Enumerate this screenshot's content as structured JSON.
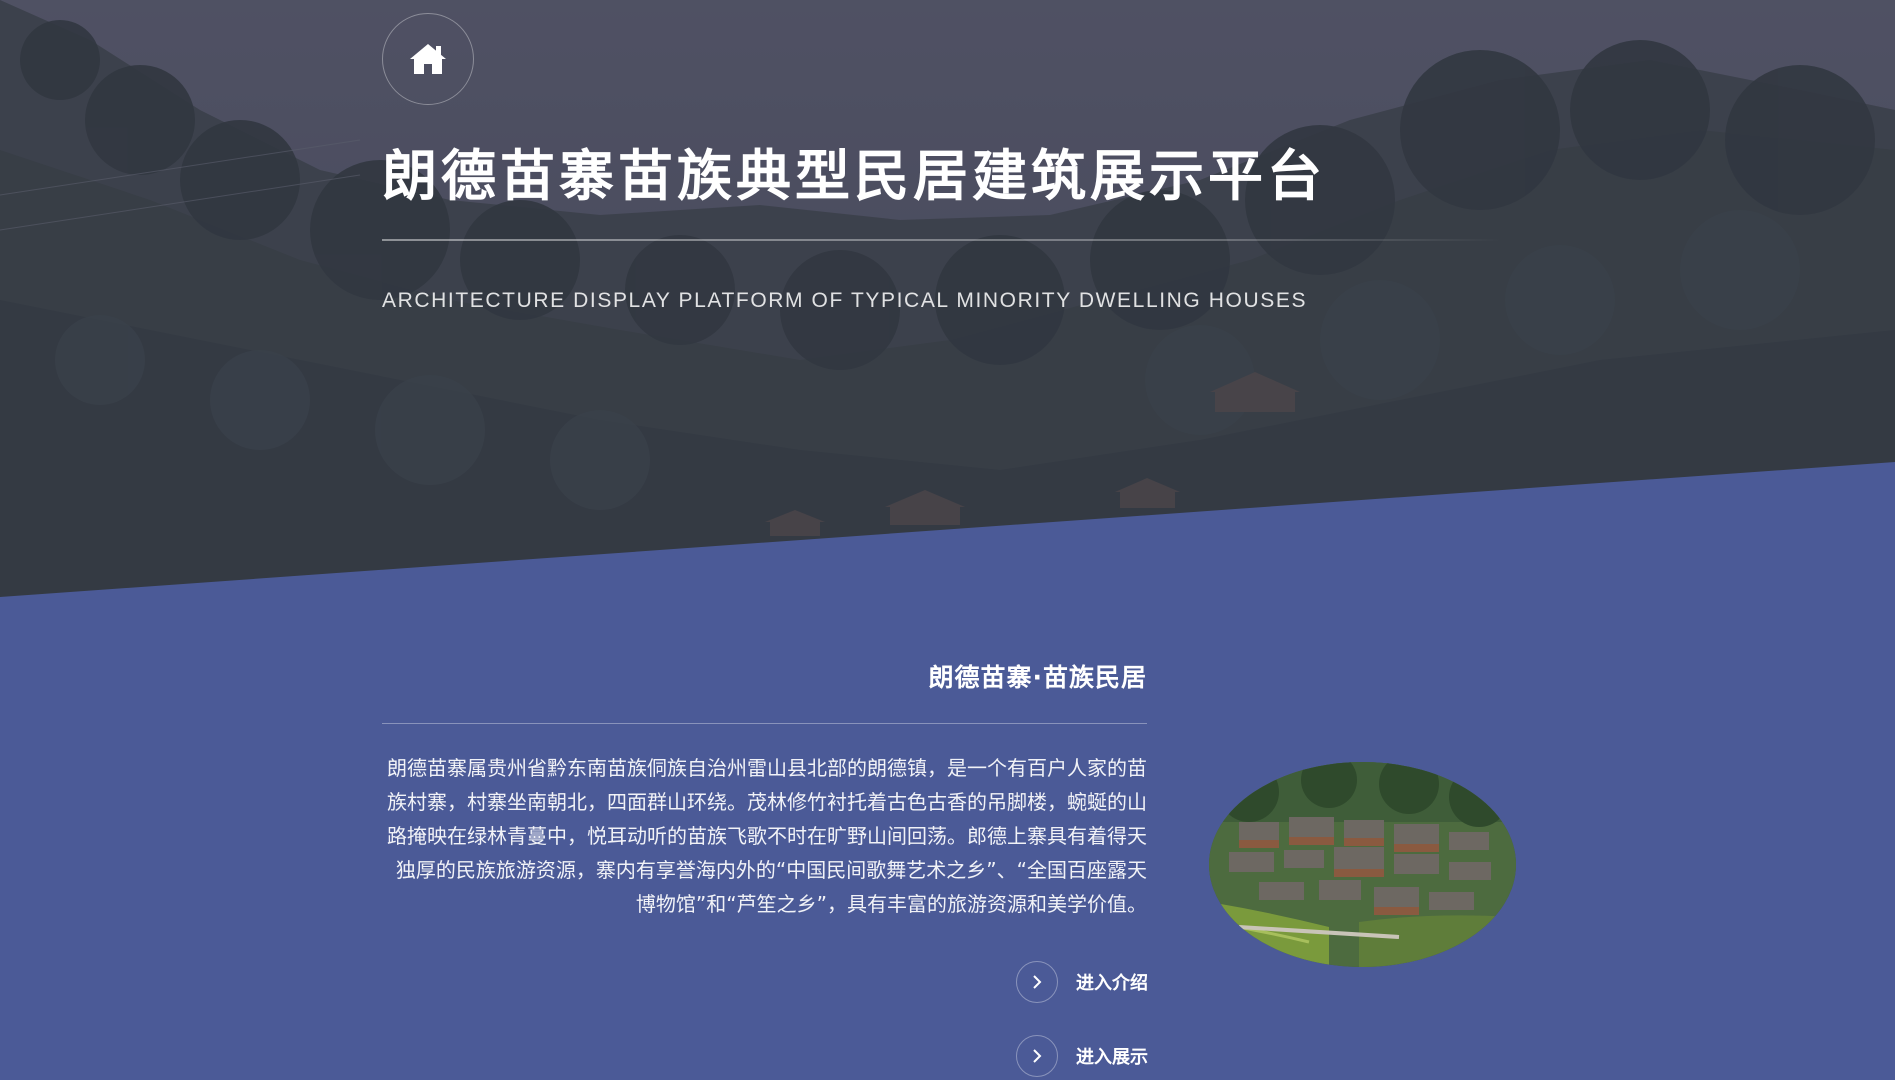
{
  "colors": {
    "accent": "#4b5a97",
    "hero_tint": "#45485a",
    "text": "#ffffff"
  },
  "header": {
    "home_icon": "home-icon",
    "title": "朗德苗寨苗族典型民居建筑展示平台",
    "subtitle": "ARCHITECTURE DISPLAY PLATFORM OF TYPICAL MINORITY DWELLING HOUSES"
  },
  "intro": {
    "title": "朗德苗寨·苗族民居",
    "description": "朗德苗寨属贵州省黔东南苗族侗族自治州雷山县北部的朗德镇，是一个有百户人家的苗族村寨，村寨坐南朝北，四面群山环绕。茂林修竹衬托着古色古香的吊脚楼，蜿蜒的山路掩映在绿林青蔓中，悦耳动听的苗族飞歌不时在旷野山间回荡。郎德上寨具有着得天独厚的民族旅游资源，寨内有享誉海内外的“中国民间歌舞艺术之乡”、“全国百座露天博物馆”和“芦笙之乡”，具有丰富的旅游资源和美学价值。",
    "links": [
      {
        "label": "进入介绍",
        "icon": "chevron-right-icon"
      },
      {
        "label": "进入展示",
        "icon": "chevron-right-icon"
      }
    ]
  }
}
